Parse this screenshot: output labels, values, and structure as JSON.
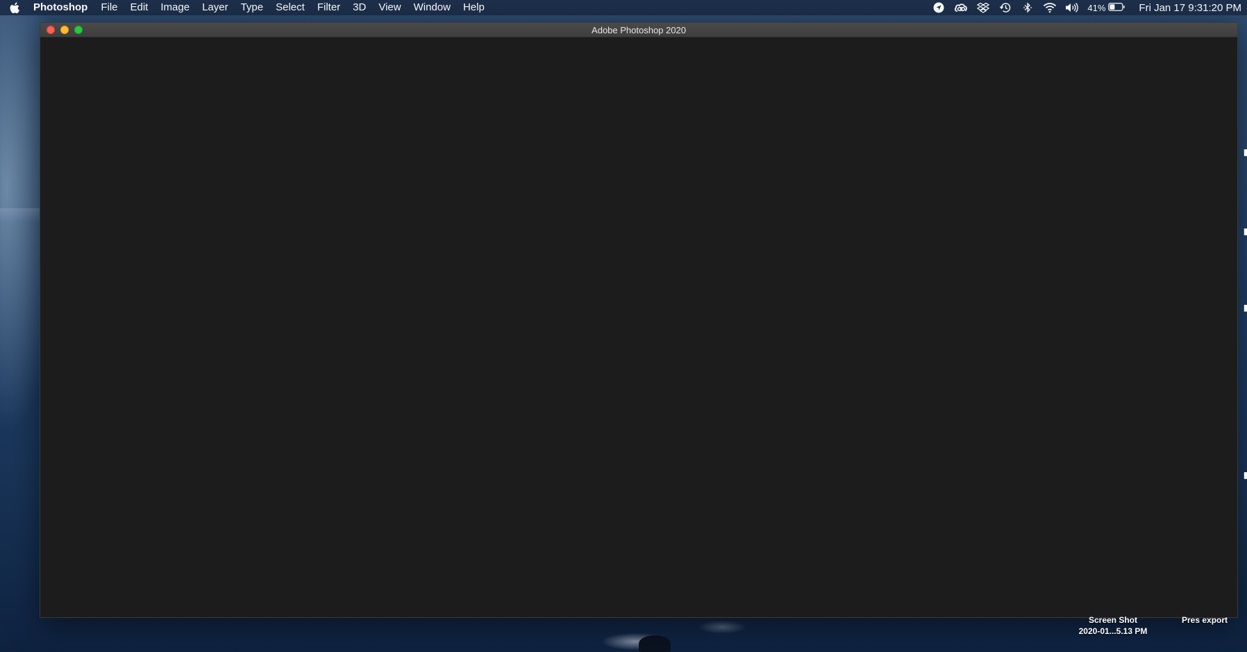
{
  "menubar": {
    "app_name": "Photoshop",
    "items": [
      "File",
      "Edit",
      "Image",
      "Layer",
      "Type",
      "Select",
      "Filter",
      "3D",
      "View",
      "Window",
      "Help"
    ],
    "status": {
      "icons": [
        "location-arrow-icon",
        "creative-cloud-icon",
        "dropbox-icon",
        "time-machine-icon",
        "bluetooth-icon",
        "wifi-icon",
        "volume-icon"
      ],
      "battery_percent": "41%",
      "clock": "Fri Jan 17  9:31:20 PM"
    }
  },
  "window": {
    "title": "Adobe Photoshop 2020"
  },
  "desktop": {
    "items": [
      {
        "line1": "Screen Shot",
        "line2": "2020-01...5.13 PM"
      },
      {
        "line1": "Pres export",
        "line2": ""
      }
    ]
  },
  "colors": {
    "menubar_bg": "#1c2c48",
    "window_bg": "#1c1c1c",
    "titlebar_bg": "#444444",
    "close": "#ff5f57",
    "minimize": "#febc2e",
    "maximize": "#28c840"
  }
}
